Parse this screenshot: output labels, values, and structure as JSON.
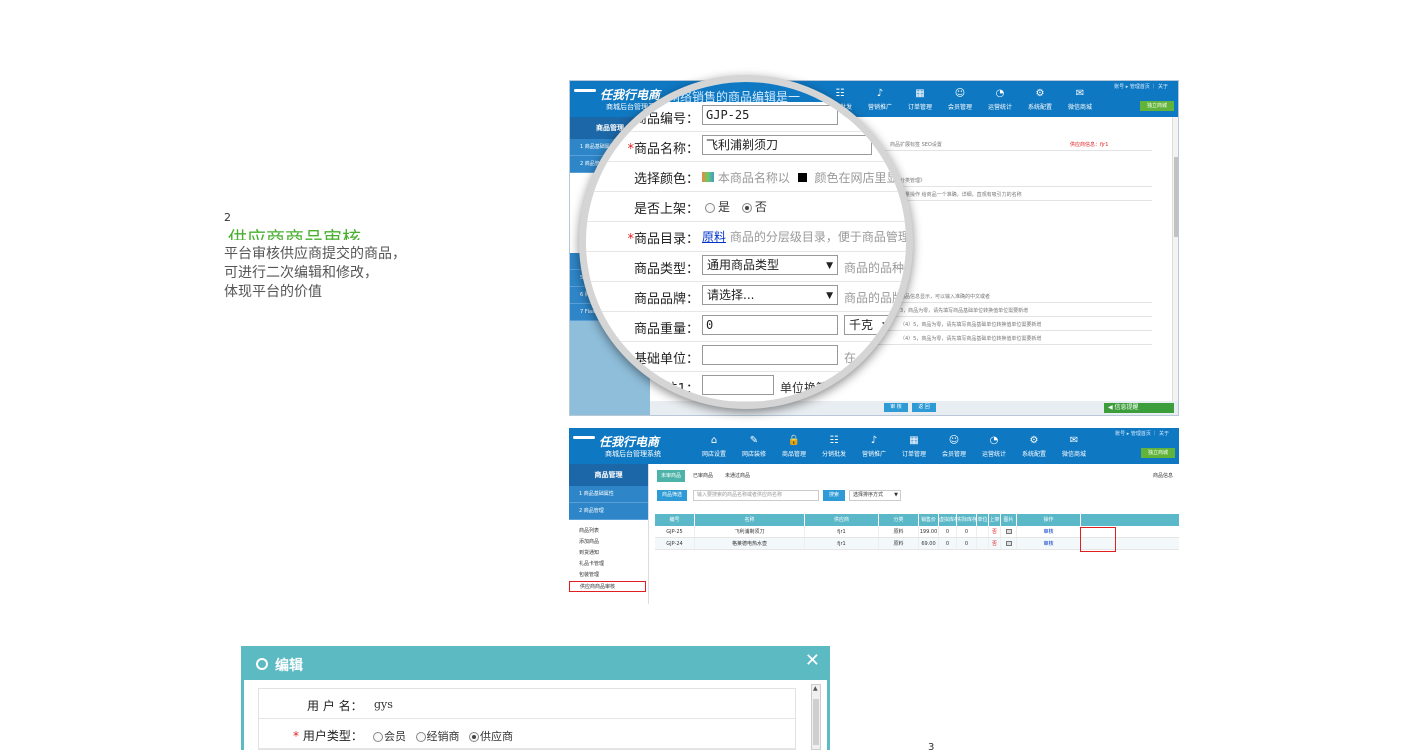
{
  "step2": {
    "number": "2",
    "title": "供应商商品审核",
    "description": "平台审核供应商提交的商品，\n可进行二次编辑和修改，\n体现平台的价值"
  },
  "step3": {
    "number": "3"
  },
  "header": {
    "logo_main": "任我行电商",
    "logo_sub": "商城后台管理系统",
    "top_links": "账号 ▸ 管理首页 ｜ 关于",
    "shop_button": "独立商城",
    "nav": [
      {
        "label": "网店设置",
        "icon": "home-icon"
      },
      {
        "label": "网店装修",
        "icon": "brush-icon"
      },
      {
        "label": "商品管理",
        "icon": "lock-icon"
      },
      {
        "label": "分销批发",
        "icon": "sitemap-icon"
      },
      {
        "label": "营销推广",
        "icon": "speaker-icon"
      },
      {
        "label": "订单管理",
        "icon": "calendar-icon"
      },
      {
        "label": "会员管理",
        "icon": "users-icon"
      },
      {
        "label": "运营统计",
        "icon": "pie-chart-icon"
      },
      {
        "label": "系统配置",
        "icon": "gear-icon"
      },
      {
        "label": "微信商城",
        "icon": "wechat-icon"
      }
    ]
  },
  "sidebar": {
    "heading": "商品管理",
    "groups": [
      "1 商品基础属性",
      "2 商品管理"
    ],
    "items": [
      "商品列表",
      "添加商品",
      "到货通知",
      "礼品卡管理",
      "包装管理",
      "供应商商品审核"
    ],
    "extra_groups": [
      "4",
      "5",
      "6 购买",
      "7 Flash营..."
    ]
  },
  "editor": {
    "crumb": "（网络销售的商品编辑是一",
    "fields": {
      "code": {
        "label": "商品编号：",
        "value": "GJP-25"
      },
      "name": {
        "label": "商品名称：",
        "value": "飞利浦剃须刀"
      },
      "color": {
        "label": "选择颜色：",
        "hint1": "本商品名称以",
        "hint2": "颜色在网店里显示"
      },
      "listed": {
        "label": "是否上架：",
        "options": [
          "是",
          "否"
        ],
        "selected": "否"
      },
      "category": {
        "label": "商品目录：",
        "link": "原料",
        "hint": "商品的分层级目录，便于商品管理，"
      },
      "type": {
        "label": "商品类型：",
        "value": "通用商品类型",
        "hint": "商品的品种类"
      },
      "brand": {
        "label": "商品品牌：",
        "value": "请选择...",
        "hint": "商品的品牌"
      },
      "weight": {
        "label": "商品重量：",
        "value": "0",
        "unit": "千克"
      },
      "base_unit": {
        "label": "基础单位：",
        "hint": "在"
      },
      "unit1": {
        "label": "位1：",
        "hint": "单位换算"
      }
    },
    "bg_tabs": "商品扩展标签    SEO设置",
    "bg_red_note": "供应商信息：fjr1",
    "bg_rows": [
      "分类管理》",
      "批量操作  给商品一个准确，详细，直观有吸引力的名称",
      "商品信息显示，可以输入准确的中文或者",
      "3，商品为零，请先填写商品基础单位转换值单位需要新增",
      "（4）5，商品为零，请先填写商品基础单位转换值单位需要新增",
      "（4）5，商品为零，请先填写商品基础单位转换值单位需要新增"
    ],
    "buttons": [
      "审 核",
      "返 回"
    ],
    "message_button": "◀ 信息提醒"
  },
  "review": {
    "tabs": [
      "未审商品",
      "已审商品",
      "未通过商品"
    ],
    "search_button": "商品筛选",
    "search_placeholder": "输入要搜索的商品名称或者供应商名称",
    "search_action": "搜索",
    "sort_label": "选择排序方式",
    "info_link": "商品信息",
    "columns": [
      "编号",
      "名称",
      "供应商",
      "分类",
      "销售价",
      "虚拟库存",
      "实际库存",
      "单位",
      "上架",
      "图片",
      "操作"
    ],
    "rows": [
      {
        "code": "GJP-25",
        "name": "飞利浦剃须刀",
        "supplier": "fjr1",
        "category": "原料",
        "price": "199.00",
        "virtual": "0",
        "actual": "0",
        "unit": "",
        "listed": "否",
        "action": "审核"
      },
      {
        "code": "GJP-24",
        "name": "格莱德电热水壶",
        "supplier": "fjr1",
        "category": "原料",
        "price": "69.00",
        "virtual": "0",
        "actual": "0",
        "unit": "",
        "listed": "否",
        "action": "审核"
      }
    ]
  },
  "dialog": {
    "title": "编辑",
    "close": "✕",
    "username_label": "用 户 名：",
    "username_value": "gys",
    "usertype_label": "用户类型：",
    "usertype_options": [
      "会员",
      "经销商",
      "供应商"
    ],
    "usertype_selected": "供应商"
  }
}
